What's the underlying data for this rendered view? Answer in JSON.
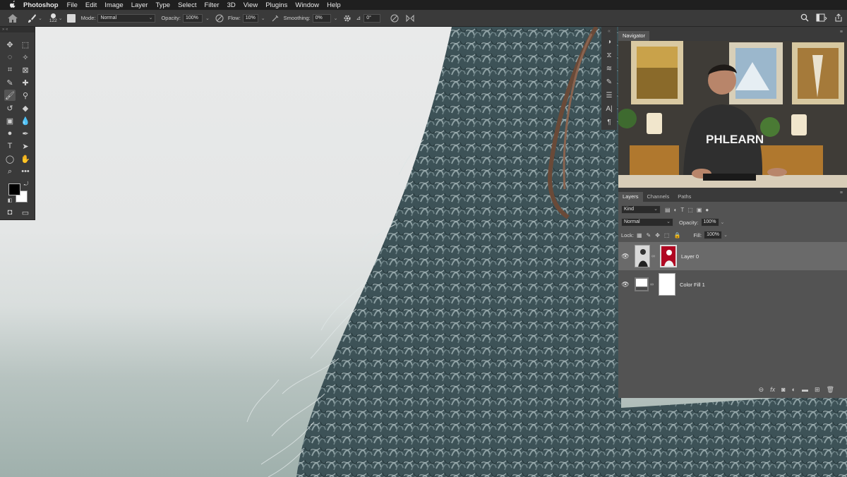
{
  "menubar": {
    "apple": "",
    "app_name": "Photoshop",
    "items": [
      "File",
      "Edit",
      "Image",
      "Layer",
      "Type",
      "Select",
      "Filter",
      "3D",
      "View",
      "Plugins",
      "Window",
      "Help"
    ]
  },
  "options": {
    "brush_size": "122",
    "mode_label": "Mode:",
    "mode_value": "Normal",
    "opacity_label": "Opacity:",
    "opacity_value": "100%",
    "flow_label": "Flow:",
    "flow_value": "10%",
    "smoothing_label": "Smoothing:",
    "smoothing_value": "0%",
    "angle_value": "0°"
  },
  "navigator": {
    "tab": "Navigator",
    "shirt_text": "PHLEARN"
  },
  "layers": {
    "tabs": [
      "Layers",
      "Channels",
      "Paths"
    ],
    "kind_value": "Kind",
    "blend_value": "Normal",
    "opacity_label": "Opacity:",
    "opacity_value": "100%",
    "lock_label": "Lock:",
    "fill_label": "Fill:",
    "fill_value": "100%",
    "items": [
      {
        "name": "Layer 0",
        "selected": true
      },
      {
        "name": "Color Fill 1",
        "selected": false
      }
    ],
    "bottom_icons": [
      "link-icon",
      "fx-icon",
      "mask-icon",
      "adjustment-icon",
      "folder-icon",
      "new-layer-icon",
      "trash-icon"
    ]
  },
  "colors": {
    "foreground": "#000000",
    "background": "#ffffff",
    "panel": "#535353",
    "selected_layer": "#6a6a6a"
  }
}
